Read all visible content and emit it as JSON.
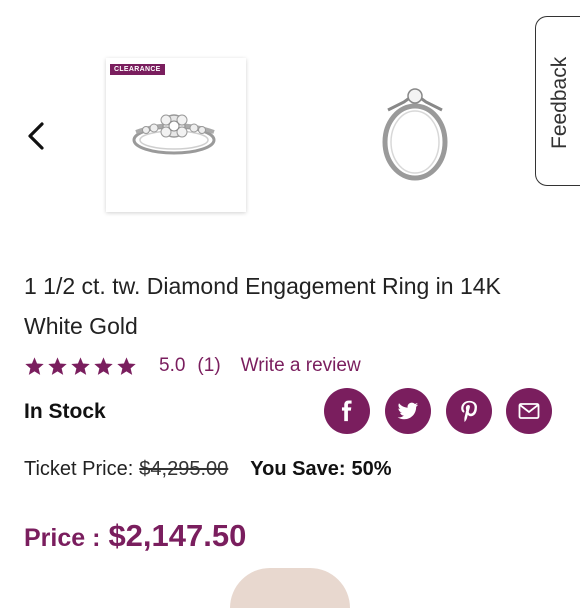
{
  "gallery": {
    "back_icon": "chevron-left-icon",
    "badge": "CLEARANCE"
  },
  "feedback": {
    "label": "Feedback"
  },
  "product": {
    "title": "1 1/2 ct. tw. Diamond Engagement Ring in 14K White Gold",
    "rating": {
      "stars": 5,
      "value": "5.0",
      "count": "(1)",
      "write_review": "Write a review"
    },
    "stock": "In Stock",
    "ticket_label": "Ticket Price:",
    "ticket_price": "$4,295.00",
    "save_label": "You Save:",
    "save_value": "50%",
    "price_label": "Price :",
    "price": "$2,147.50"
  },
  "social": {
    "icons": [
      "facebook-icon",
      "twitter-icon",
      "pinterest-icon",
      "email-icon"
    ]
  },
  "colors": {
    "accent": "#7a1e5e"
  }
}
